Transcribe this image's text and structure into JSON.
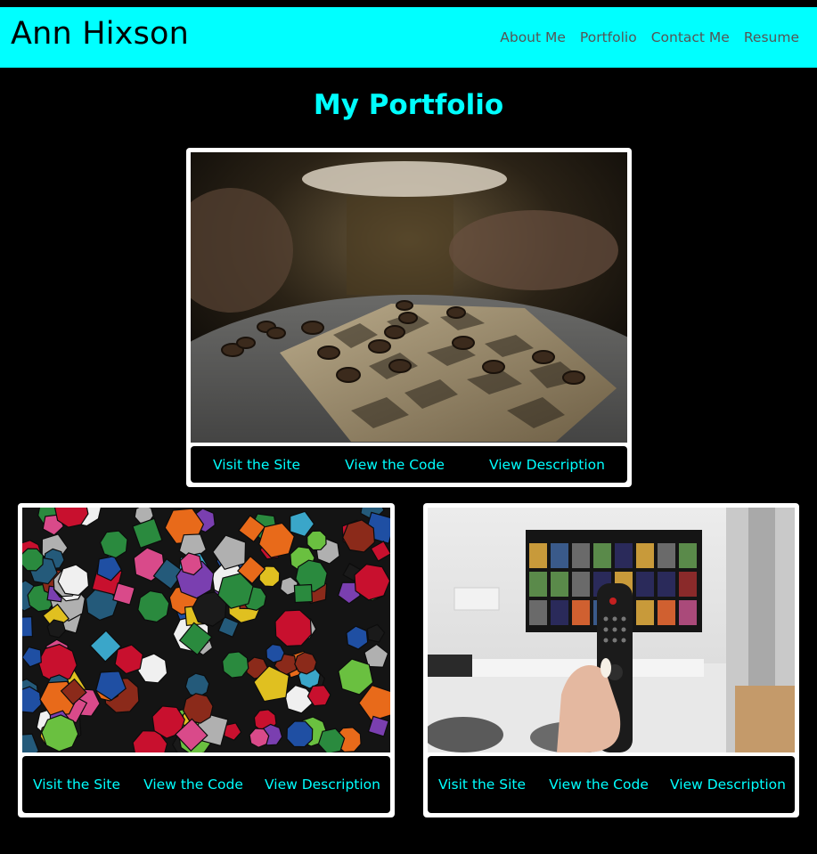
{
  "header": {
    "brand": "Ann Hixson",
    "nav": [
      "About Me",
      "Portfolio",
      "Contact Me",
      "Resume"
    ],
    "bg_color": "#00ffff"
  },
  "main": {
    "title": "My Portfolio",
    "accent_color": "#00ffff"
  },
  "projects": [
    {
      "image": "checkers-board-photo",
      "links": [
        "Visit the Site",
        "View the Code",
        "View Description"
      ]
    },
    {
      "image": "polyhedral-dice-photo",
      "links": [
        "Visit the Site",
        "View the Code",
        "View Description"
      ]
    },
    {
      "image": "tv-remote-photo",
      "links": [
        "Visit the Site",
        "View the Code",
        "View Description"
      ]
    }
  ]
}
